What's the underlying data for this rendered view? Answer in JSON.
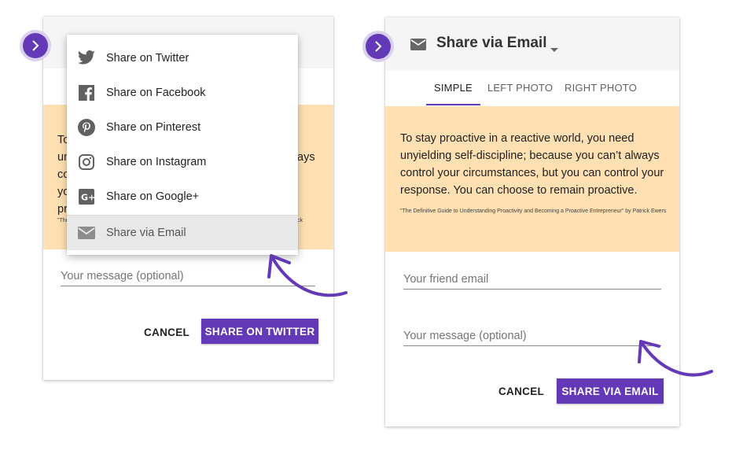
{
  "left_dialog": {
    "quote_fragments": [
      "To",
      "un",
      "co",
      "yo",
      "pr"
    ],
    "quote_fragment_right": "ays",
    "source_fragment_left": "\"The",
    "source_fragment_right": "ck",
    "message_placeholder": "Your message (optional)",
    "cancel_label": "CANCEL",
    "share_label": "SHARE ON TWITTER"
  },
  "share_menu": {
    "items": [
      {
        "label": "Share on Twitter",
        "icon": "twitter-icon"
      },
      {
        "label": "Share on Facebook",
        "icon": "facebook-icon"
      },
      {
        "label": "Share on Pinterest",
        "icon": "pinterest-icon"
      },
      {
        "label": "Share on Instagram",
        "icon": "instagram-icon"
      },
      {
        "label": "Share on Google+",
        "icon": "google-plus-icon"
      },
      {
        "label": "Share via Email",
        "icon": "email-icon",
        "selected": true
      }
    ]
  },
  "right_dialog": {
    "title": "Share via Email",
    "tabs": [
      {
        "label": "SIMPLE",
        "active": true
      },
      {
        "label": "LEFT PHOTO",
        "active": false
      },
      {
        "label": "RIGHT PHOTO",
        "active": false
      }
    ],
    "quote": "To stay proactive in a reactive world, you need unyielding self-discipline; because you can’t always control your circumstances, but you can control your response. You can choose to remain proactive.",
    "source": "\"The Definitive Guide to Understanding Proactivity and Becoming a Proactive Entrepreneur\" by Patrick Ewers",
    "friend_email_placeholder": "Your friend email",
    "message_placeholder": "Your message (optional)",
    "cancel_label": "CANCEL",
    "share_label": "SHARE VIA EMAIL"
  },
  "colors": {
    "accent": "#6439b8",
    "quote_background": "#ffe0b2",
    "header_background": "#f5f5f5"
  }
}
